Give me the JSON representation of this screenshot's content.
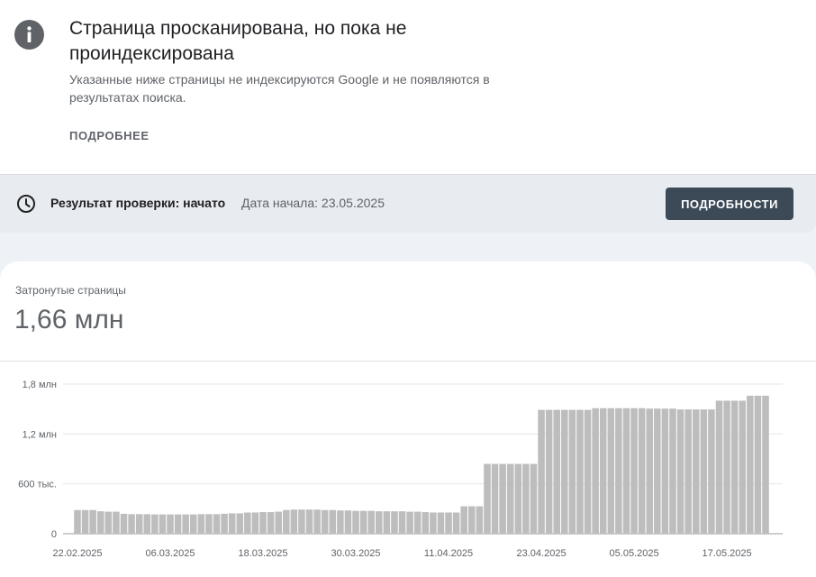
{
  "issue": {
    "title": "Страница просканирована, но пока не проиндексирована",
    "description": "Указанные ниже страницы не индексируются Google и не появляются в результатах поиска.",
    "more_label": "ПОДРОБНЕЕ",
    "icon": "info-icon"
  },
  "status": {
    "icon": "clock-icon",
    "label": "Результат проверки: начато",
    "start_date": "Дата начала: 23.05.2025",
    "details_button": "ПОДРОБНОСТИ"
  },
  "metric": {
    "label": "Затронутые страницы",
    "value": "1,66 млн"
  },
  "colors": {
    "bar": "#bdbdbd",
    "button_bg": "#3c4a57",
    "band_bg": "#e8ebef"
  },
  "chart_data": {
    "type": "bar",
    "y_ticks": [
      {
        "value": 0,
        "label": "0"
      },
      {
        "value": 600000,
        "label": "600 тыс."
      },
      {
        "value": 1200000,
        "label": "1,2 млн"
      },
      {
        "value": 1800000,
        "label": "1,8 млн"
      }
    ],
    "ylim": [
      0,
      1800000
    ],
    "x_tick_labels": [
      {
        "index": 0,
        "label": "22.02.2025"
      },
      {
        "index": 12,
        "label": "06.03.2025"
      },
      {
        "index": 24,
        "label": "18.03.2025"
      },
      {
        "index": 36,
        "label": "30.03.2025"
      },
      {
        "index": 48,
        "label": "11.04.2025"
      },
      {
        "index": 60,
        "label": "23.04.2025"
      },
      {
        "index": 72,
        "label": "05.05.2025"
      },
      {
        "index": 84,
        "label": "17.05.2025"
      }
    ],
    "values": [
      285000,
      285000,
      285000,
      270000,
      265000,
      265000,
      240000,
      235000,
      235000,
      235000,
      232000,
      232000,
      232000,
      232000,
      232000,
      232000,
      235000,
      235000,
      235000,
      240000,
      245000,
      245000,
      255000,
      255000,
      260000,
      260000,
      265000,
      285000,
      290000,
      290000,
      290000,
      290000,
      285000,
      285000,
      280000,
      280000,
      275000,
      275000,
      275000,
      270000,
      270000,
      270000,
      270000,
      265000,
      265000,
      260000,
      255000,
      255000,
      255000,
      255000,
      330000,
      330000,
      330000,
      840000,
      840000,
      840000,
      840000,
      840000,
      840000,
      840000,
      1490000,
      1490000,
      1490000,
      1490000,
      1490000,
      1490000,
      1490000,
      1510000,
      1510000,
      1510000,
      1510000,
      1510000,
      1510000,
      1510000,
      1505000,
      1505000,
      1505000,
      1505000,
      1495000,
      1495000,
      1495000,
      1495000,
      1495000,
      1600000,
      1600000,
      1600000,
      1600000,
      1660000,
      1660000,
      1660000
    ]
  }
}
